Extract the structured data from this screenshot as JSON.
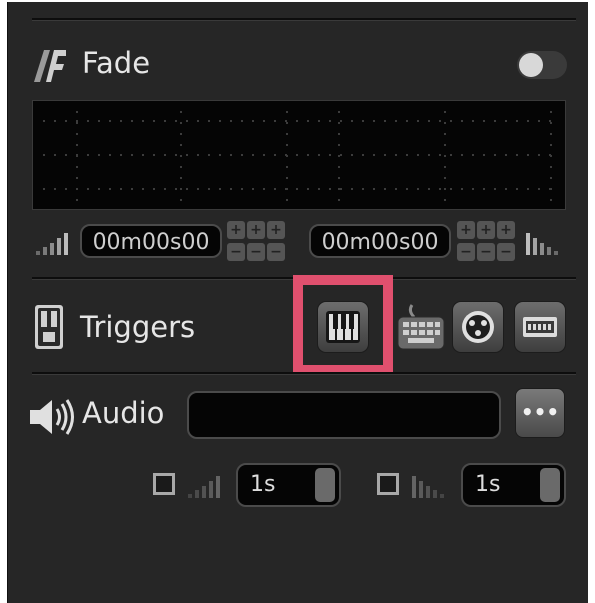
{
  "fade": {
    "title": "Fade",
    "fade_in_time": "00m00s00",
    "fade_out_time": "00m00s00",
    "toggle_state": "off"
  },
  "triggers": {
    "title": "Triggers",
    "buttons": [
      "midi-trigger",
      "keyboard-trigger",
      "dmx-trigger",
      "timecode-trigger"
    ],
    "highlighted": "midi-trigger",
    "highlight_color": "#e0506e"
  },
  "audio": {
    "title": "Audio",
    "file_value": "",
    "browse_label": "•••",
    "fade_in_value": "1s",
    "fade_out_value": "1s"
  },
  "colors": {
    "panel": "#262626",
    "field": "#050505",
    "text": "#e6e6e6"
  }
}
